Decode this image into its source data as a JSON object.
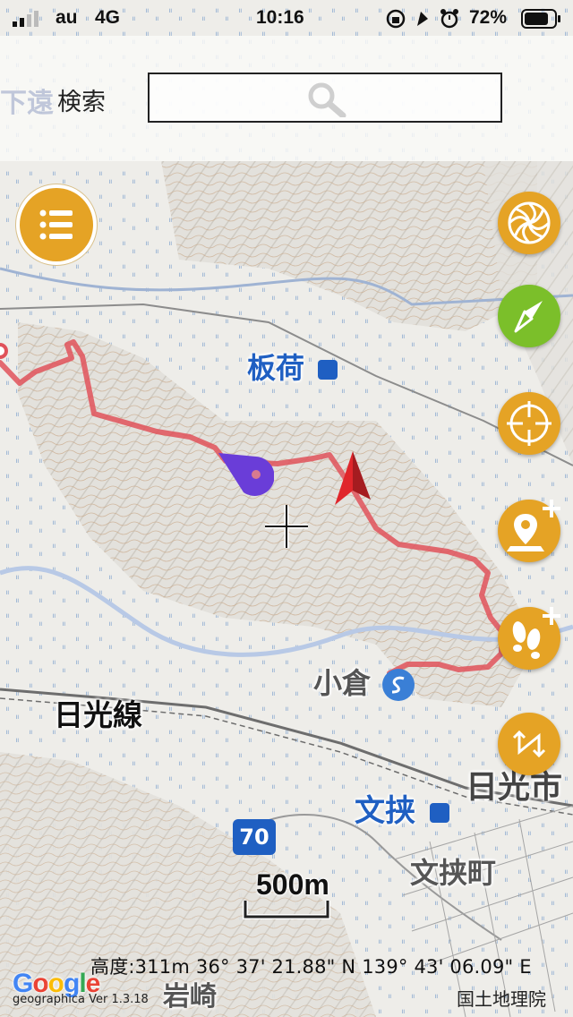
{
  "status_bar": {
    "carrier": "au",
    "network": "4G",
    "time": "10:16",
    "battery_percent": "72%",
    "icons": [
      "signal-icon",
      "orientation-lock-icon",
      "location-arrow-icon",
      "alarm-icon",
      "battery-icon"
    ]
  },
  "search": {
    "ghost_label": "下遠",
    "label": "検索",
    "placeholder": "",
    "icon": "search-icon"
  },
  "map_labels": {
    "itaga": "板荷",
    "nikko_line": "日光線",
    "ogura": "小倉",
    "fubasami": "文挟",
    "nikko_city": "日光市",
    "fubasami_town": "文挟町",
    "iwasaki": "岩崎",
    "route_number": "70"
  },
  "buttons": {
    "menu": "menu-icon",
    "layers": "aperture-icon",
    "compass": "compass-icon",
    "locate": "crosshair-target-icon",
    "add_point": "add-pin-icon",
    "add_track": "add-footprints-icon",
    "route": "route-icon"
  },
  "scale_bar": {
    "label": "500m"
  },
  "footer": {
    "coordinates": "高度:311m  36° 37' 21.88\" N 139° 43' 06.09\" E",
    "google_logo": "Google",
    "version": "geographica Ver 1.3.18",
    "copyright": "国土地理院"
  },
  "colors": {
    "button_orange": "#E5A325",
    "button_green": "#7BBF2A",
    "track_red": "#E0525A",
    "marker_purple": "#6A3DD8",
    "arrow_red": "#D8262A",
    "station_blue": "#1F5FC2"
  }
}
